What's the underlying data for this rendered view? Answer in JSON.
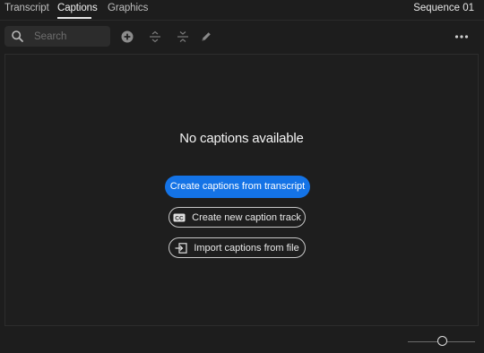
{
  "tabs": [
    {
      "label": "Transcript",
      "active": false
    },
    {
      "label": "Captions",
      "active": true
    },
    {
      "label": "Graphics",
      "active": false
    }
  ],
  "sequence_name": "Sequence 01",
  "search": {
    "placeholder": "Search",
    "value": ""
  },
  "toolbar": {
    "icons": [
      "add-circle-icon",
      "merge-icon",
      "split-icon",
      "pencil-icon",
      "more-options-icon"
    ]
  },
  "empty_state": {
    "title": "No captions available",
    "primary_button": "Create captions from transcript",
    "new_track_button": "Create new caption track",
    "new_track_icon": "cc-icon",
    "import_button": "Import captions from file",
    "import_icon": "import-file-icon"
  },
  "colors": {
    "accent": "#1473e6",
    "background": "#1d1d1d"
  }
}
